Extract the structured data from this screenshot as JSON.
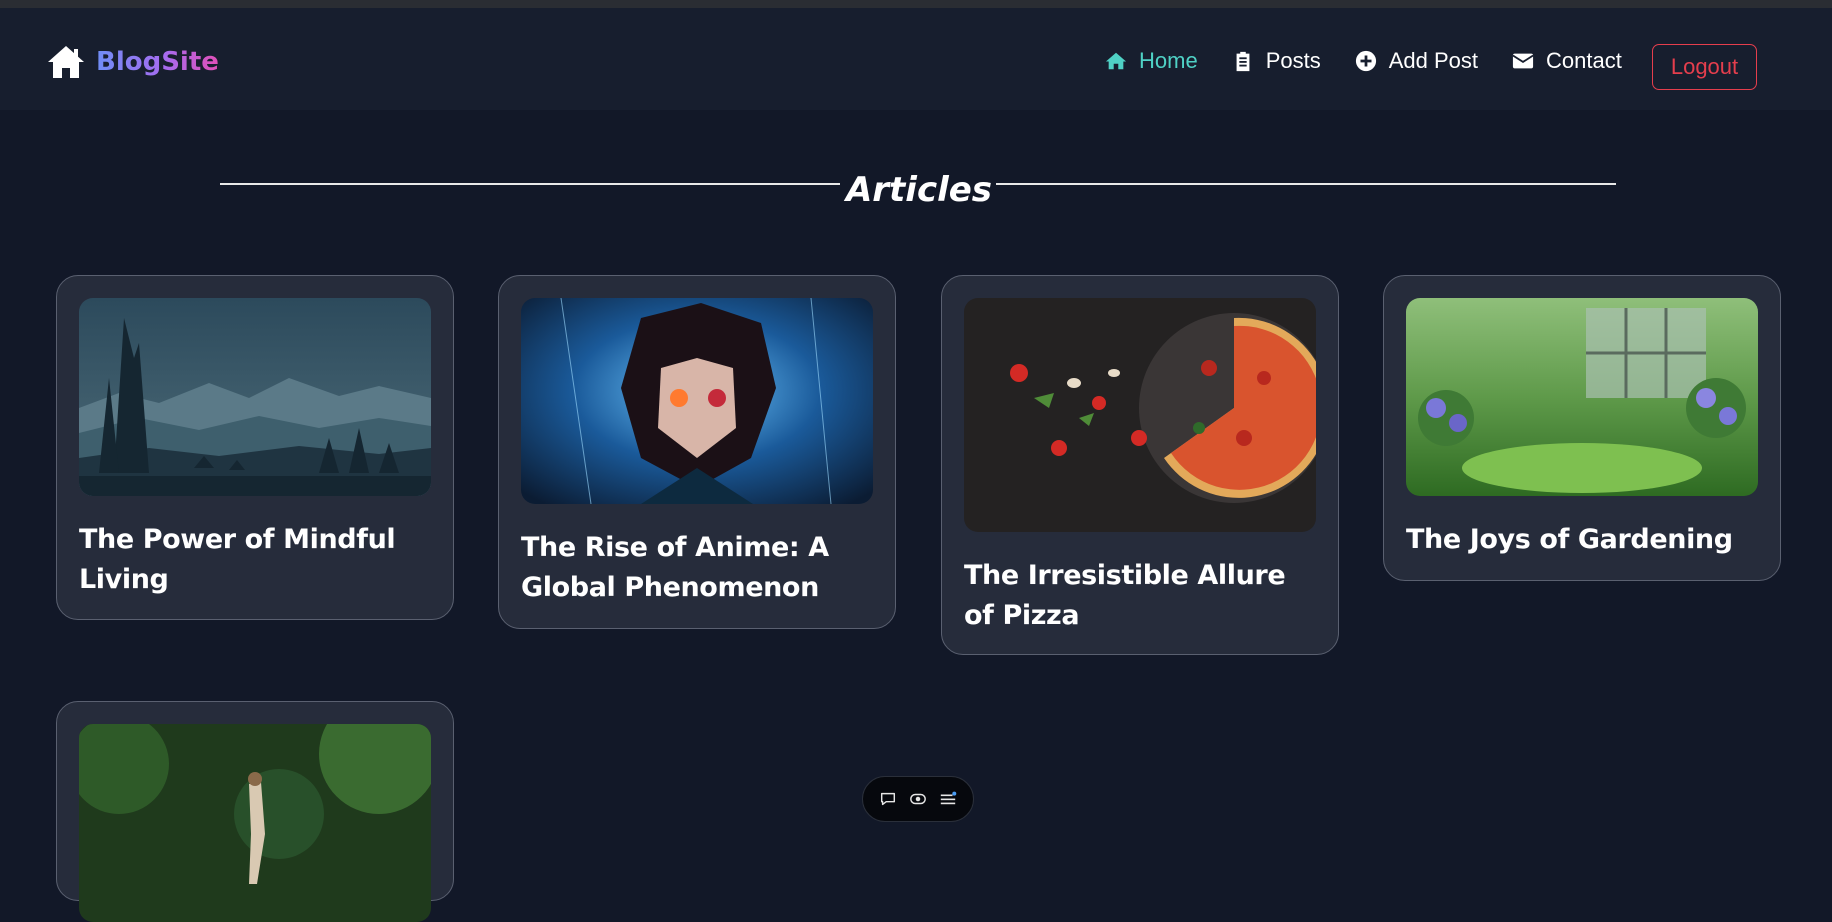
{
  "brand": {
    "name": "BlogSite",
    "icon": "home-icon"
  },
  "nav": {
    "items": [
      {
        "label": "Home",
        "icon": "home-icon",
        "active": true
      },
      {
        "label": "Posts",
        "icon": "clipboard-icon",
        "active": false
      },
      {
        "label": "Add Post",
        "icon": "plus-circle-icon",
        "active": false
      },
      {
        "label": "Contact",
        "icon": "envelope-icon",
        "active": false
      }
    ],
    "logout_label": "Logout"
  },
  "page": {
    "heading": "Articles"
  },
  "articles": [
    {
      "title": "The Power of Mindful Living",
      "image": "mountain-landscape-with-deer"
    },
    {
      "title": "The Rise of Anime: A Global Phenomenon",
      "image": "anime-character-illustration"
    },
    {
      "title": "The Irresistible Allure of Pizza",
      "image": "pizza-with-ingredients"
    },
    {
      "title": "The Joys of Gardening",
      "image": "lush-garden-scene"
    },
    {
      "title": "",
      "image": "person-walking-in-forest"
    }
  ],
  "floating_toolbar": {
    "icons": [
      "comment-icon",
      "eye-icon",
      "menu-icon"
    ]
  },
  "colors": {
    "background": "#121828",
    "navbar": "#171e2e",
    "card": "#262c3b",
    "active_nav": "#4fd1c5",
    "logout": "#e53e4d"
  }
}
